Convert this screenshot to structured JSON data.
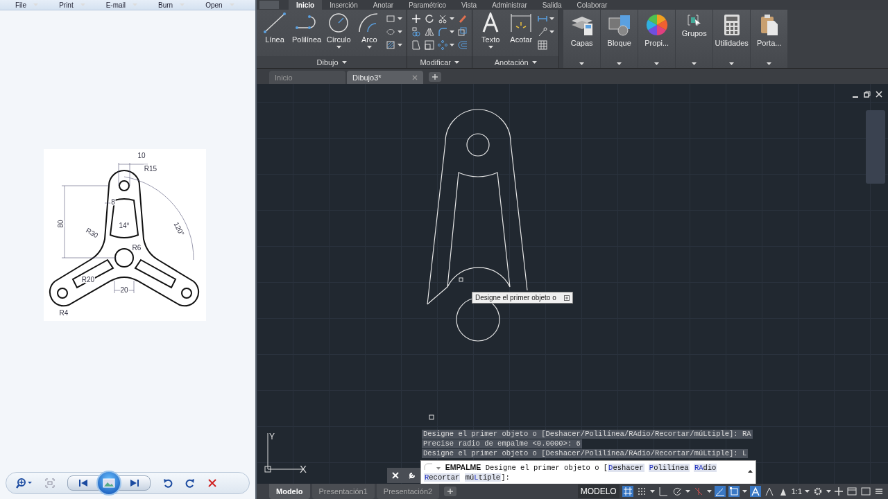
{
  "viewer": {
    "menu": [
      {
        "label": "File"
      },
      {
        "label": "Print"
      },
      {
        "label": "E-mail"
      },
      {
        "label": "Burn"
      },
      {
        "label": "Open"
      }
    ],
    "image": {
      "dimension_labels": [
        "10",
        "R15",
        "8",
        "80",
        "R30",
        "14°",
        "120°",
        "R6",
        "R20",
        "20",
        "R4"
      ]
    }
  },
  "ribbon": {
    "tabs": [
      {
        "label": "Inicio",
        "selected": true
      },
      {
        "label": "Inserción",
        "selected": false
      },
      {
        "label": "Anotar",
        "selected": false
      },
      {
        "label": "Paramétrico",
        "selected": false
      },
      {
        "label": "Vista",
        "selected": false
      },
      {
        "label": "Administrar",
        "selected": false
      },
      {
        "label": "Salida",
        "selected": false
      },
      {
        "label": "Colaborar",
        "selected": false
      }
    ],
    "panels": [
      {
        "title": "Dibujo",
        "tools": [
          {
            "label": "Línea",
            "dropdown": false
          },
          {
            "label": "Polilínea",
            "dropdown": false
          },
          {
            "label": "Círculo",
            "dropdown": true
          },
          {
            "label": "Arco",
            "dropdown": true
          }
        ]
      },
      {
        "title": "Modificar"
      },
      {
        "title": "Anotación",
        "tools": [
          {
            "label": "Texto",
            "dropdown": true
          },
          {
            "label": "Acotar",
            "dropdown": false
          }
        ]
      }
    ],
    "big_buttons": [
      {
        "label": "Capas"
      },
      {
        "label": "Bloque"
      },
      {
        "label": "Propi..."
      },
      {
        "label": "Grupos"
      },
      {
        "label": "Utilidades"
      },
      {
        "label": "Porta..."
      }
    ]
  },
  "file_tabs": [
    {
      "label": "Inicio",
      "selected": false,
      "closable": false
    },
    {
      "label": "Dibujo3*",
      "selected": true,
      "closable": true
    }
  ],
  "canvas": {
    "tooltip": "Designe el primer objeto o",
    "ucs": {
      "x": "X",
      "y": "Y"
    }
  },
  "command": {
    "history": [
      "Designe el primer objeto o [Deshacer/Polilínea/RAdio/Recortar/múLtiple]: RA",
      "Precise radio de empalme <0.0000>: 6",
      "Designe el primer objeto o [Deshacer/Polilínea/RAdio/Recortar/múLtiple]: L"
    ],
    "prompt": {
      "command": "EMPALME",
      "text": "Designe el primer objeto o [",
      "options": [
        {
          "key": "D",
          "after": "eshacer"
        },
        {
          "key": "P",
          "after": "olilínea"
        },
        {
          "key": "RA",
          "after": "dio"
        },
        {
          "key": "R",
          "after": "ecortar"
        },
        {
          "before": "mú",
          "key": "L",
          "after": "tiple"
        }
      ],
      "end": "]:"
    }
  },
  "layout_tabs": [
    {
      "label": "Modelo",
      "selected": true
    },
    {
      "label": "Presentación1",
      "selected": false
    },
    {
      "label": "Presentación2",
      "selected": false
    }
  ],
  "status_bar": {
    "mode": "MODELO",
    "scale": "1:1"
  }
}
